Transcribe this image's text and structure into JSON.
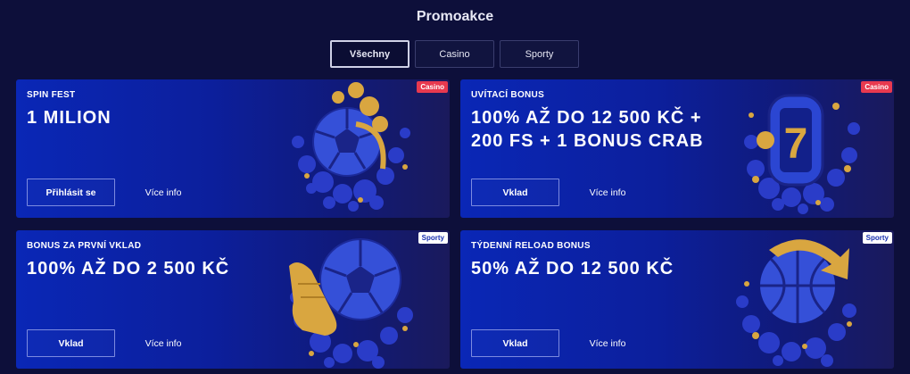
{
  "page": {
    "title": "Promoakce"
  },
  "tabs": [
    {
      "label": "Všechny",
      "active": true
    },
    {
      "label": "Casino",
      "active": false
    },
    {
      "label": "Sporty",
      "active": false
    }
  ],
  "promos": [
    {
      "badge": "Casino",
      "eyebrow": "SPIN FEST",
      "headline": "1 MILION",
      "primary_button": "Přihlásit se",
      "info_link": "Více info",
      "art_icon": "soccer-ball-coins-icon"
    },
    {
      "badge": "Casino",
      "eyebrow": "UVÍTACÍ BONUS",
      "headline": "100% AŽ DO 12 500 KČ + 200 FS + 1 BONUS CRAB",
      "primary_button": "Vklad",
      "info_link": "Více info",
      "art_icon": "slot-reel-seven-icon"
    },
    {
      "badge": "Sporty",
      "eyebrow": "BONUS ZA PRVNÍ VKLAD",
      "headline": "100% AŽ DO 2 500 KČ",
      "primary_button": "Vklad",
      "info_link": "Více info",
      "art_icon": "soccer-ball-boot-icon"
    },
    {
      "badge": "Sporty",
      "eyebrow": "TÝDENNÍ RELOAD BONUS",
      "headline": "50% AŽ DO 12 500 KČ",
      "primary_button": "Vklad",
      "info_link": "Více info",
      "art_icon": "basketball-arrow-icon"
    }
  ],
  "colors": {
    "page_background": "#0d0f3a",
    "card_blue": "#0a27b6",
    "badge_casino": "#e8394f",
    "badge_sport": "#ffffff",
    "accent_gold": "#d9a640"
  }
}
